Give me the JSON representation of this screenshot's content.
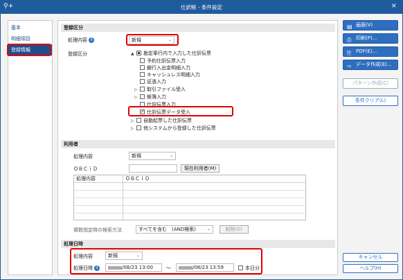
{
  "window": {
    "title": "仕訳帳 - 条件設定",
    "app_icon": "search-plus-icon",
    "close_label": "×"
  },
  "sidebar": {
    "items": [
      {
        "label": "基本",
        "active": false
      },
      {
        "label": "明細項目",
        "active": false
      },
      {
        "label": "登録情報",
        "active": true
      }
    ]
  },
  "registration": {
    "heading": "登録区分",
    "process_label": "処理内容",
    "process_value": "新規",
    "category_label": "登録区分",
    "tree": [
      {
        "label": "勘定奉行内で入力した仕訳伝票",
        "state": "partial",
        "toggle": "▲"
      },
      {
        "label": "予約仕訳伝票入力",
        "state": "unchecked",
        "toggle": ""
      },
      {
        "label": "銀行入出金明細入力",
        "state": "unchecked",
        "toggle": ""
      },
      {
        "label": "キャッシュレス明細入力",
        "state": "unchecked",
        "toggle": ""
      },
      {
        "label": "証憑入力",
        "state": "unchecked",
        "toggle": ""
      },
      {
        "label": "取引ファイル受入",
        "state": "unchecked",
        "toggle": "▷"
      },
      {
        "label": "帳簿入力",
        "state": "unchecked",
        "toggle": "▷"
      },
      {
        "label": "仕訳伝票入力",
        "state": "unchecked",
        "toggle": ""
      },
      {
        "label": "仕訳伝票データ受入",
        "state": "checked",
        "toggle": ""
      },
      {
        "label": "自動起票した仕訳伝票",
        "state": "unchecked",
        "toggle": "▷"
      },
      {
        "label": "他システムから登録した仕訳伝票",
        "state": "unchecked",
        "toggle": "▷"
      }
    ]
  },
  "user": {
    "heading": "利用者",
    "process_label": "処理内容",
    "process_value": "新規",
    "obcid_label": "ＯＢＣｉＤ",
    "obcid_value": "",
    "current_user_button": "現在利用者(M)",
    "grid_headers": [
      "処理内容",
      "ＯＢＣｉＤ"
    ],
    "search_method_label": "複数指定時の検索方法",
    "search_method_value": "すべてを含む　(AND検索)",
    "delete_button": "削除(D)"
  },
  "datetime": {
    "heading": "処理日時",
    "process_label": "処理内容",
    "process_value": "新規",
    "datetime_label": "処理日時",
    "from_value": "/08/23 13:00",
    "to_value": "/08/23 13:59",
    "separator": "～",
    "today_label": "本日分"
  },
  "actions": {
    "screen": {
      "label": "画面(V)",
      "icon": "screen-icon"
    },
    "print": {
      "label": "印刷(P)...",
      "icon": "printer-icon"
    },
    "pdf": {
      "label": "PDF(E)...",
      "icon": "pdf-icon"
    },
    "data": {
      "label": "データ作成(E)...",
      "icon": "data-export-icon"
    },
    "pattern": "パターン作成(C)",
    "clear": "条件クリア(L)",
    "cancel": "キャンセル",
    "help": "ヘルプ(H)"
  },
  "colors": {
    "accent": "#2e6ec0",
    "titlebar": "#1f5c9e",
    "highlight": "#e00000"
  }
}
